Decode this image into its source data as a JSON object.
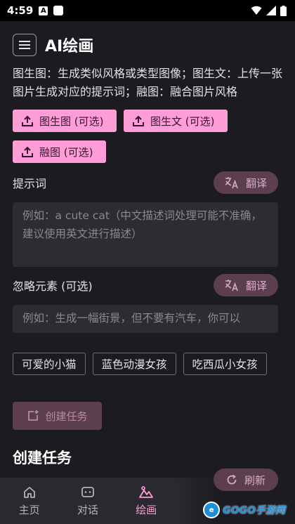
{
  "status_bar": {
    "time": "4:59",
    "a_icon": "A"
  },
  "header": {
    "title": "AI绘画"
  },
  "description": "图生图：生成类似风格或类型图像；图生文：上传一张图片生成对应的提示词；融图：融合图片风格",
  "upload_buttons": [
    {
      "label": "图生图 (可选)",
      "icon": "upload-icon"
    },
    {
      "label": "图生文 (可选)",
      "icon": "upload-icon"
    },
    {
      "label": "融图 (可选)",
      "icon": "upload-icon"
    }
  ],
  "prompt": {
    "label": "提示词",
    "translate_label": "翻译",
    "placeholder": "例如：a cute cat（中文描述词处理可能不准确，建议使用英文进行描述）"
  },
  "negative": {
    "label": "忽略元素 (可选)",
    "translate_label": "翻译",
    "placeholder": "例如：生成一幅街景，但不要有汽车，你可以"
  },
  "tags": [
    "可爱的小猫",
    "蓝色动漫女孩",
    "吃西瓜小女孩"
  ],
  "create_button": "创建任务",
  "tasks": {
    "title": "创建任务",
    "refresh_label": "刷新"
  },
  "nav": [
    {
      "label": "主页",
      "icon": "home-icon",
      "active": false
    },
    {
      "label": "对话",
      "icon": "chat-icon",
      "active": false
    },
    {
      "label": "绘画",
      "icon": "paint-icon",
      "active": true
    }
  ],
  "watermark": {
    "logo": "e",
    "text": "GOGO手游网"
  },
  "colors": {
    "accent": "#ff9ed6",
    "background": "#1c1b1f",
    "button_muted": "#5c3f4e"
  }
}
